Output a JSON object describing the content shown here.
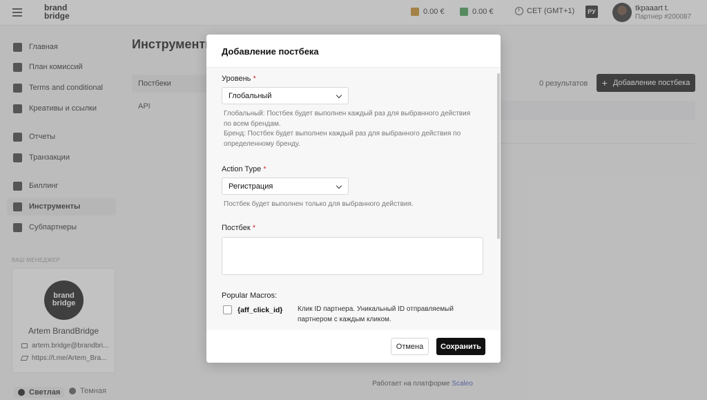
{
  "header": {
    "logo_line1": "brand",
    "logo_line2": "bridge",
    "wallet1": "0.00 €",
    "wallet2": "0.00 €",
    "timezone": "CET (GMT+1)",
    "lang": "РУ",
    "user_name": "tkpaaart t.",
    "user_id": "Партнер #200087",
    "colors": {
      "wallet1": "#c8891e",
      "wallet2": "#3f9a4d"
    }
  },
  "sidebar": {
    "items": [
      {
        "label": "Главная",
        "icon": "home-grid-icon"
      },
      {
        "label": "План комиссий",
        "icon": "tag-icon"
      },
      {
        "label": "Terms and conditional",
        "icon": "document-icon"
      },
      {
        "label": "Креативы и ссылки",
        "icon": "image-link-icon"
      },
      {
        "label": "Отчеты",
        "icon": "bar-chart-icon"
      },
      {
        "label": "Транзакции",
        "icon": "transactions-icon"
      },
      {
        "label": "Биллинг",
        "icon": "card-icon"
      },
      {
        "label": "Инструменты",
        "icon": "wrench-icon"
      },
      {
        "label": "Субпартнеры",
        "icon": "subpartners-icon"
      }
    ],
    "active_index": 7,
    "manager_title": "ВАШ МЕНЕДЖЕР",
    "manager": {
      "logo_line1": "brand",
      "logo_line2": "bridge",
      "name": "Artem BrandBridge",
      "email": "artem.bridge@brandbri...",
      "telegram": "https://t.me/Artem_Bra..."
    },
    "theme_light": "Светлая",
    "theme_dark": "Темная"
  },
  "main": {
    "title": "Инструменты",
    "subnav_active": "Постбеки",
    "subnav_api": "API",
    "results": "0  результатов",
    "add_button": "Добавление постбека",
    "footer_prefix": "Работает на платформе",
    "footer_brand": "Scaleo"
  },
  "modal": {
    "title": "Добавление постбека",
    "level_label": "Уровень",
    "level_value": "Глобальный",
    "level_hint1": "Глобальный: Постбек будет выполнен каждый раз для выбранного действия по всем брендам.",
    "level_hint2": "Бренд: Постбек будет выполнен каждый раз для выбранного действия по определенному бренду.",
    "action_label": "Action Type",
    "action_value": "Регистрация",
    "action_hint": "Постбек будет выполнен только для выбранного действия.",
    "postback_label": "Постбек",
    "postback_value": "",
    "macros_label": "Popular Macros:",
    "macro_code": "{aff_click_id}",
    "macro_desc": "Клик ID партнера. Уникальный ID отправляемый партнером с каждым кликом.",
    "required_mark": "*",
    "cancel": "Отмена",
    "save": "Сохранить"
  }
}
